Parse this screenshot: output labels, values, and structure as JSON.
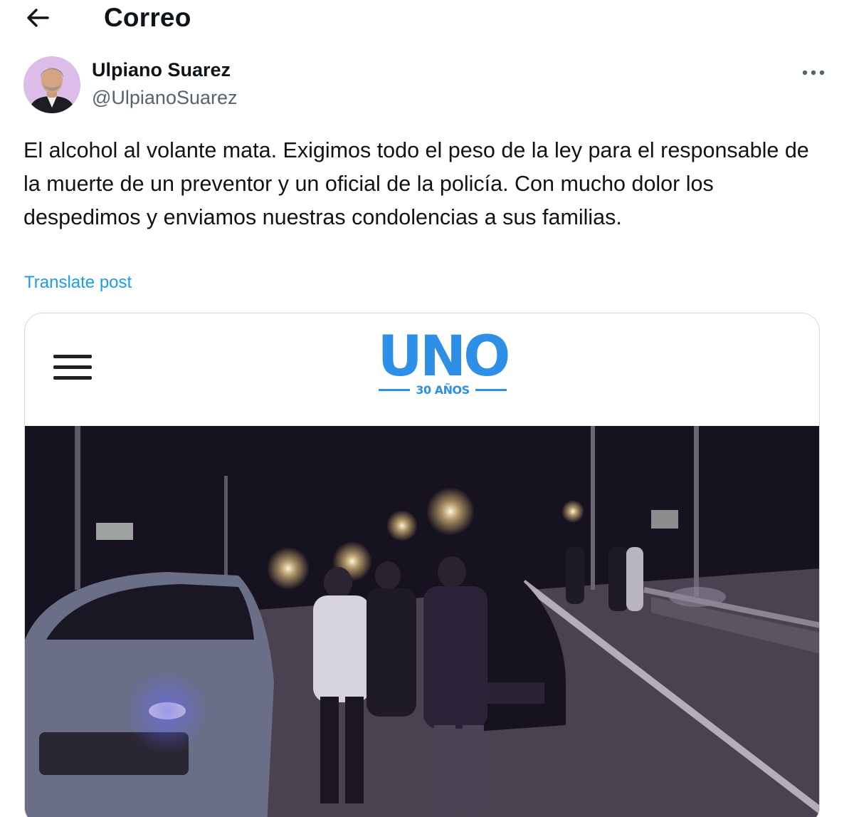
{
  "header": {
    "title": "Correo",
    "back_icon": "arrow-left-icon"
  },
  "author": {
    "name": "Ulpiano Suarez",
    "handle": "@UlpianoSuarez",
    "avatar_bg": "#d9b8e6"
  },
  "post": {
    "text": "El alcohol al volante mata. Exigimos todo el peso de la ley para el responsable de la muerte de un preventor y un oficial de la policía. Con mucho dolor los despedimos y enviamos nuestras condolencias a sus familias.",
    "translate_label": "Translate post"
  },
  "card": {
    "logo_text": "UNO",
    "logo_subtitle": "30 AÑOS",
    "logo_color": "#2d8fe6",
    "menu_icon": "hamburger-menu-icon",
    "photo_description": "Night scene on a highway with cars, police lights and people gathered at an accident site"
  },
  "colors": {
    "link": "#1d9bf0",
    "secondary_text": "#536471",
    "border": "#cfd9de"
  }
}
